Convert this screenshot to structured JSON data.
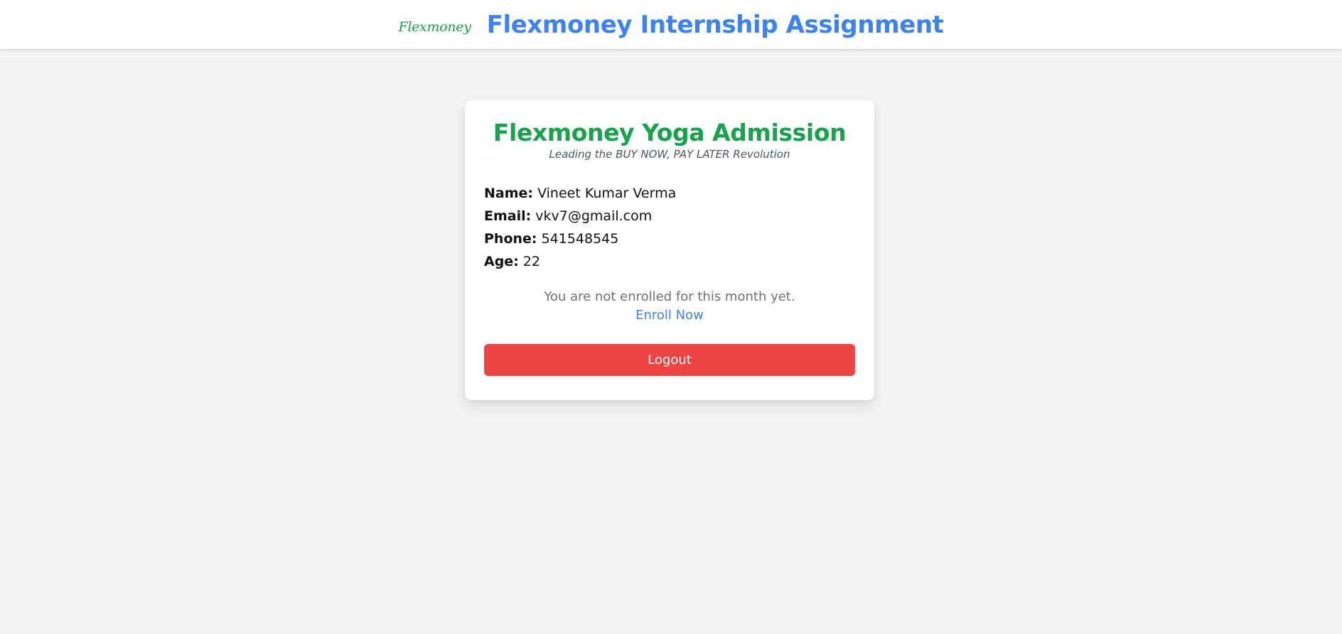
{
  "header": {
    "logo_text": "Flexmoney",
    "title": "Flexmoney Internship Assignment"
  },
  "card": {
    "title": "Flexmoney Yoga Admission",
    "tagline": "Leading the BUY NOW, PAY LATER Revolution",
    "details": [
      {
        "label": "Name:",
        "value": "Vineet Kumar Verma"
      },
      {
        "label": "Email:",
        "value": "vkv7@gmail.com"
      },
      {
        "label": "Phone:",
        "value": "541548545"
      },
      {
        "label": "Age:",
        "value": "22"
      }
    ],
    "enroll_status": "You are not enrolled for this month yet.",
    "enroll_link": "Enroll Now",
    "logout_label": "Logout"
  },
  "colors": {
    "brand_green": "#16a34a",
    "brand_blue": "#3b82f6",
    "logout_red": "#ef4444",
    "page_background": "#f2f3f5"
  }
}
